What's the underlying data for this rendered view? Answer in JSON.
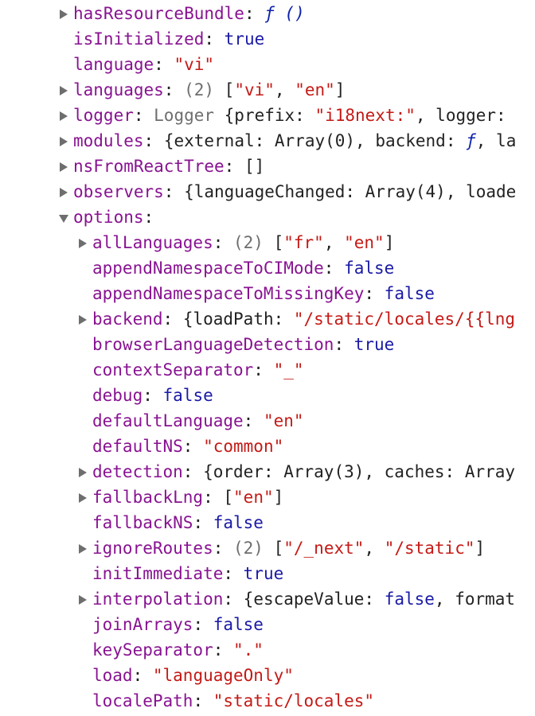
{
  "colors": {
    "key": "#881391",
    "boolean": "#1a1aa6",
    "string": "#c41a16",
    "number": "#1a1aa6",
    "muted": "#6e6e6e",
    "text": "#222222",
    "function": "#0d22aa"
  },
  "rows": [
    {
      "key": "hasResourceBundle",
      "level": 0,
      "toggle": "collapsed",
      "parts": [
        {
          "t": "fn",
          "v": "ƒ ()"
        }
      ]
    },
    {
      "key": "isInitialized",
      "level": 0,
      "toggle": "none",
      "parts": [
        {
          "t": "bool",
          "v": "true"
        }
      ]
    },
    {
      "key": "language",
      "level": 0,
      "toggle": "none",
      "parts": [
        {
          "t": "str",
          "v": "\"vi\""
        }
      ]
    },
    {
      "key": "languages",
      "level": 0,
      "toggle": "collapsed",
      "parts": [
        {
          "t": "gray",
          "v": "(2)"
        },
        {
          "t": "p",
          "v": " ["
        },
        {
          "t": "str",
          "v": "\"vi\""
        },
        {
          "t": "p",
          "v": ", "
        },
        {
          "t": "str",
          "v": "\"en\""
        },
        {
          "t": "p",
          "v": "]"
        }
      ]
    },
    {
      "key": "logger",
      "level": 0,
      "toggle": "collapsed",
      "parts": [
        {
          "t": "gray",
          "v": "Logger"
        },
        {
          "t": "p",
          "v": " {prefix: "
        },
        {
          "t": "str",
          "v": "\"i18next:\""
        },
        {
          "t": "p",
          "v": ", logger: "
        }
      ]
    },
    {
      "key": "modules",
      "level": 0,
      "toggle": "collapsed",
      "parts": [
        {
          "t": "p",
          "v": "{external: Array(0), backend: "
        },
        {
          "t": "fn",
          "v": "ƒ"
        },
        {
          "t": "p",
          "v": ", la"
        }
      ]
    },
    {
      "key": "nsFromReactTree",
      "level": 0,
      "toggle": "collapsed",
      "parts": [
        {
          "t": "p",
          "v": "[]"
        }
      ]
    },
    {
      "key": "observers",
      "level": 0,
      "toggle": "collapsed",
      "parts": [
        {
          "t": "p",
          "v": "{languageChanged: Array(4), loade"
        }
      ]
    },
    {
      "key": "options",
      "level": 0,
      "toggle": "expanded",
      "parts": []
    },
    {
      "key": "allLanguages",
      "level": 1,
      "toggle": "collapsed",
      "parts": [
        {
          "t": "gray",
          "v": "(2)"
        },
        {
          "t": "p",
          "v": " ["
        },
        {
          "t": "str",
          "v": "\"fr\""
        },
        {
          "t": "p",
          "v": ", "
        },
        {
          "t": "str",
          "v": "\"en\""
        },
        {
          "t": "p",
          "v": "]"
        }
      ]
    },
    {
      "key": "appendNamespaceToCIMode",
      "level": 1,
      "toggle": "none",
      "parts": [
        {
          "t": "bool",
          "v": "false"
        }
      ]
    },
    {
      "key": "appendNamespaceToMissingKey",
      "level": 1,
      "toggle": "none",
      "parts": [
        {
          "t": "bool",
          "v": "false"
        }
      ]
    },
    {
      "key": "backend",
      "level": 1,
      "toggle": "collapsed",
      "parts": [
        {
          "t": "p",
          "v": "{loadPath: "
        },
        {
          "t": "str",
          "v": "\"/static/locales/{{lng"
        }
      ]
    },
    {
      "key": "browserLanguageDetection",
      "level": 1,
      "toggle": "none",
      "parts": [
        {
          "t": "bool",
          "v": "true"
        }
      ]
    },
    {
      "key": "contextSeparator",
      "level": 1,
      "toggle": "none",
      "parts": [
        {
          "t": "str",
          "v": "\"_\""
        }
      ]
    },
    {
      "key": "debug",
      "level": 1,
      "toggle": "none",
      "parts": [
        {
          "t": "bool",
          "v": "false"
        }
      ]
    },
    {
      "key": "defaultLanguage",
      "level": 1,
      "toggle": "none",
      "parts": [
        {
          "t": "str",
          "v": "\"en\""
        }
      ]
    },
    {
      "key": "defaultNS",
      "level": 1,
      "toggle": "none",
      "parts": [
        {
          "t": "str",
          "v": "\"common\""
        }
      ]
    },
    {
      "key": "detection",
      "level": 1,
      "toggle": "collapsed",
      "parts": [
        {
          "t": "p",
          "v": "{order: Array(3), caches: Array"
        }
      ]
    },
    {
      "key": "fallbackLng",
      "level": 1,
      "toggle": "collapsed",
      "parts": [
        {
          "t": "p",
          "v": "["
        },
        {
          "t": "str",
          "v": "\"en\""
        },
        {
          "t": "p",
          "v": "]"
        }
      ]
    },
    {
      "key": "fallbackNS",
      "level": 1,
      "toggle": "none",
      "parts": [
        {
          "t": "bool",
          "v": "false"
        }
      ]
    },
    {
      "key": "ignoreRoutes",
      "level": 1,
      "toggle": "collapsed",
      "parts": [
        {
          "t": "gray",
          "v": "(2)"
        },
        {
          "t": "p",
          "v": " ["
        },
        {
          "t": "str",
          "v": "\"/_next\""
        },
        {
          "t": "p",
          "v": ", "
        },
        {
          "t": "str",
          "v": "\"/static\""
        },
        {
          "t": "p",
          "v": "]"
        }
      ]
    },
    {
      "key": "initImmediate",
      "level": 1,
      "toggle": "none",
      "parts": [
        {
          "t": "bool",
          "v": "true"
        }
      ]
    },
    {
      "key": "interpolation",
      "level": 1,
      "toggle": "collapsed",
      "parts": [
        {
          "t": "p",
          "v": "{escapeValue: "
        },
        {
          "t": "bool",
          "v": "false"
        },
        {
          "t": "p",
          "v": ", format"
        }
      ]
    },
    {
      "key": "joinArrays",
      "level": 1,
      "toggle": "none",
      "parts": [
        {
          "t": "bool",
          "v": "false"
        }
      ]
    },
    {
      "key": "keySeparator",
      "level": 1,
      "toggle": "none",
      "parts": [
        {
          "t": "str",
          "v": "\".\""
        }
      ]
    },
    {
      "key": "load",
      "level": 1,
      "toggle": "none",
      "parts": [
        {
          "t": "str",
          "v": "\"languageOnly\""
        }
      ]
    },
    {
      "key": "localePath",
      "level": 1,
      "toggle": "none",
      "parts": [
        {
          "t": "str",
          "v": "\"static/locales\""
        }
      ]
    }
  ]
}
